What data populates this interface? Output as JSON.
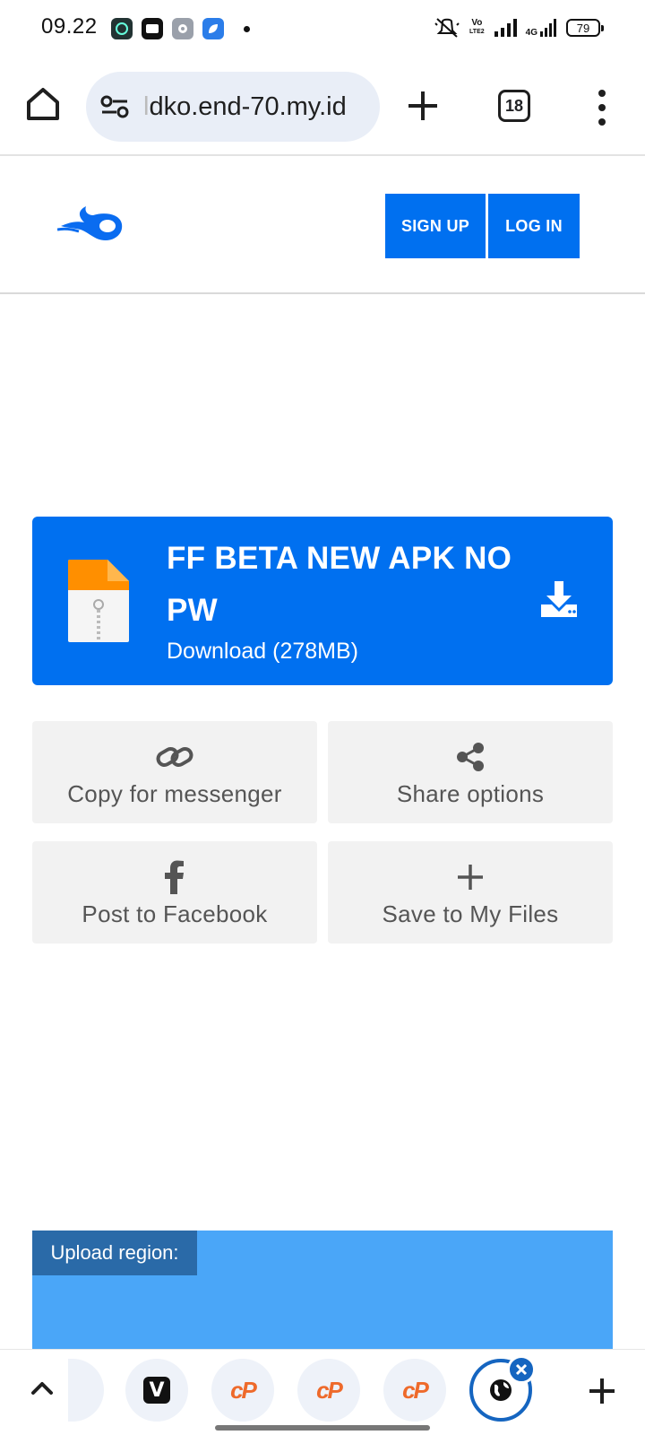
{
  "status_bar": {
    "time": "09.22",
    "net_label_1": "Vo",
    "net_label_2": "LTE2",
    "net_label_3": "4G",
    "battery": "79"
  },
  "browser": {
    "url_prefix": "l",
    "url": "dko.end-70.my.id",
    "tab_count": "18",
    "icons": [
      "home-icon",
      "tune-icon",
      "plus-icon",
      "tab-switcher-icon",
      "more-vert-icon"
    ]
  },
  "site": {
    "signup_label": "SIGN UP",
    "login_label": "LOG IN",
    "brand_color": "#0070f0"
  },
  "file": {
    "title": "FF BETA NEW APK NO PW",
    "download_label": "Download (278MB)"
  },
  "actions": {
    "copy_label": "Copy for messenger",
    "share_label": "Share options",
    "facebook_label": "Post to Facebook",
    "save_label": "Save to My Files"
  },
  "upload": {
    "label": "Upload region:"
  },
  "tab_strip": {
    "v_label": "V",
    "cp_label": "cP"
  }
}
